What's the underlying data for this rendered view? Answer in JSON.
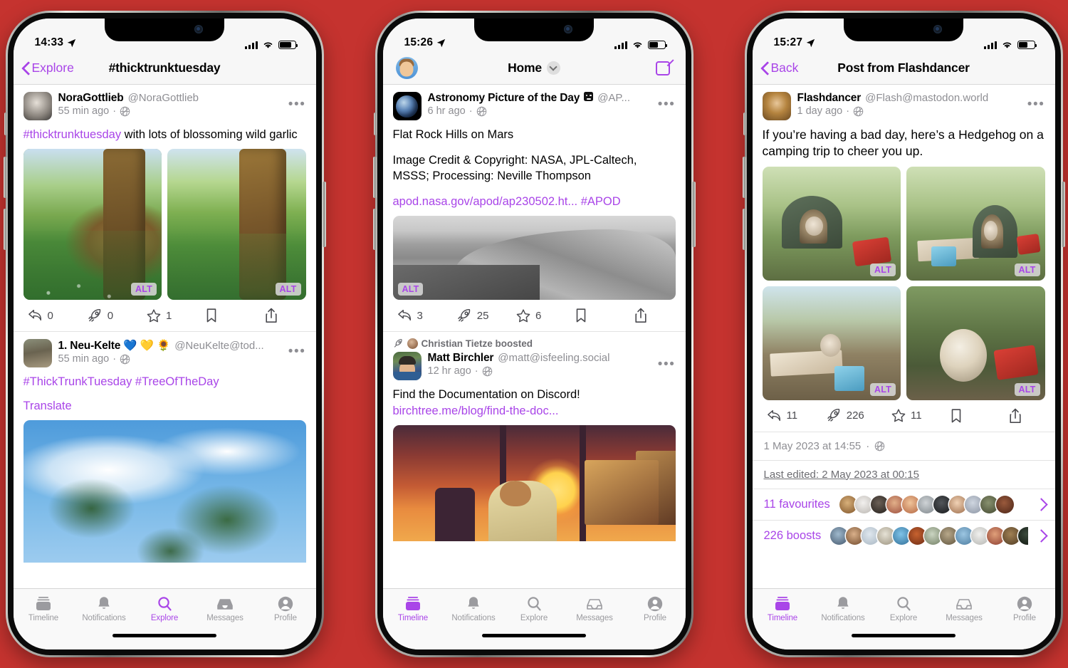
{
  "page": {
    "background_color": "#C5332F",
    "accent_color": "#A945E8"
  },
  "phones": [
    {
      "id": "phone-explore",
      "status": {
        "time": "14:33",
        "location_icon": "location-arrow-icon"
      },
      "nav": {
        "back_label": "Explore",
        "title": "#thicktrunktuesday"
      },
      "posts": [
        {
          "author": "NoraGottlieb",
          "handle": "@NoraGottlieb",
          "time": "55 min ago",
          "visibility_icon": "unlisted-globe-icon",
          "body_hashtag": "#thicktrunktuesday",
          "body_rest": " with lots of blossoming wild garlic",
          "media_alt": "ALT",
          "actions": {
            "reply": "0",
            "boost": "0",
            "favourite": "1",
            "bookmark": "",
            "share": ""
          }
        },
        {
          "author": "1. Neu-Kelte 💙 💛 🌻",
          "handle": "@NeuKelte@tod...",
          "time": "55 min ago",
          "visibility_icon": "unlisted-globe-icon",
          "tags": "#ThickTrunkTuesday #TreeOfTheDay",
          "translate_label": "Translate"
        }
      ],
      "tabs": [
        {
          "label": "Timeline",
          "icon": "timeline-icon",
          "active": false
        },
        {
          "label": "Notifications",
          "icon": "bell-icon",
          "active": false
        },
        {
          "label": "Explore",
          "icon": "search-icon",
          "active": true
        },
        {
          "label": "Messages",
          "icon": "inbox-icon",
          "active": false
        },
        {
          "label": "Profile",
          "icon": "person-icon",
          "active": false
        }
      ]
    },
    {
      "id": "phone-home",
      "status": {
        "time": "15:26",
        "location_icon": "location-arrow-icon"
      },
      "nav": {
        "title": "Home",
        "avatar_icon": "user-avatar-icon",
        "compose_icon": "compose-icon",
        "chevron_icon": "chevron-down-icon"
      },
      "posts": [
        {
          "author": "Astronomy Picture of the Day",
          "verified_icon": "bot-badge-icon",
          "handle": "@AP...",
          "time": "6 hr ago",
          "visibility_icon": "unlisted-globe-icon",
          "title_line": "Flat Rock Hills on Mars",
          "credit_line": "Image Credit & Copyright: NASA, JPL-Caltech, MSSS; Processing: Neville Thompson",
          "link": "apod.nasa.gov/apod/ap230502.ht...",
          "link_tag": "#APOD",
          "media_alt": "ALT",
          "actions": {
            "reply": "3",
            "boost": "25",
            "favourite": "6",
            "bookmark": "",
            "share": ""
          }
        },
        {
          "boosted_by": "Christian Tietze boosted",
          "author": "Matt Birchler",
          "handle": "@matt@isfeeling.social",
          "time": "12 hr ago",
          "visibility_icon": "unlisted-globe-icon",
          "body": "Find the Documentation on Discord!",
          "link": "birchtree.me/blog/find-the-doc..."
        }
      ],
      "tabs": [
        {
          "label": "Timeline",
          "icon": "timeline-icon",
          "active": true
        },
        {
          "label": "Notifications",
          "icon": "bell-icon",
          "active": false
        },
        {
          "label": "Explore",
          "icon": "search-icon",
          "active": false
        },
        {
          "label": "Messages",
          "icon": "inbox-icon",
          "active": false
        },
        {
          "label": "Profile",
          "icon": "person-icon",
          "active": false
        }
      ]
    },
    {
      "id": "phone-detail",
      "status": {
        "time": "15:27",
        "location_icon": "location-arrow-icon"
      },
      "nav": {
        "back_label": "Back",
        "title": "Post from Flashdancer"
      },
      "post": {
        "author": "Flashdancer",
        "handle": "@Flash@mastodon.world",
        "time": "1 day ago",
        "visibility_icon": "unlisted-globe-icon",
        "body": "If you’re having a bad day, here’s a Hedgehog on a camping trip to cheer you up.",
        "media_alt": "ALT",
        "actions": {
          "reply": "11",
          "boost": "226",
          "favourite": "11",
          "bookmark": "",
          "share": ""
        },
        "timestamp": "1 May 2023 at 14:55",
        "last_edited": "Last edited: 2 May 2023 at 00:15",
        "favourites_label": "11 favourites",
        "boosts_label": "226 boosts"
      },
      "tabs": [
        {
          "label": "Timeline",
          "icon": "timeline-icon",
          "active": true
        },
        {
          "label": "Notifications",
          "icon": "bell-icon",
          "active": false
        },
        {
          "label": "Explore",
          "icon": "search-icon",
          "active": false
        },
        {
          "label": "Messages",
          "icon": "inbox-icon",
          "active": false
        },
        {
          "label": "Profile",
          "icon": "person-icon",
          "active": false
        }
      ]
    }
  ]
}
